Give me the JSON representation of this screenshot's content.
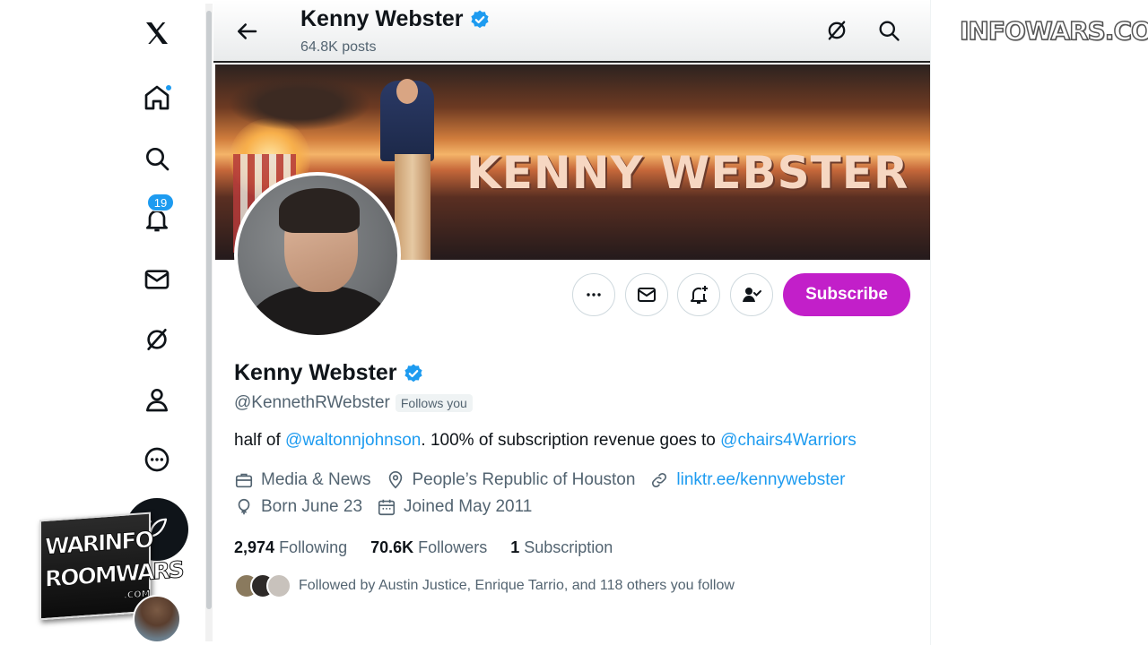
{
  "nav": {
    "items": [
      "x-logo",
      "home",
      "explore",
      "notifications",
      "messages",
      "grok",
      "profile",
      "more"
    ],
    "notifications_count": "19"
  },
  "header": {
    "name": "Kenny Webster",
    "posts": "64.8K posts"
  },
  "banner": {
    "text": "KENNY WEBSTER"
  },
  "actions": {
    "subscribe_label": "Subscribe"
  },
  "profile": {
    "name": "Kenny Webster",
    "handle": "@KennethRWebster",
    "follows_you": "Follows you",
    "bio_prefix": "half of ",
    "bio_link1": "@waltonnjohnson",
    "bio_middle": ". 100% of subscription revenue goes to ",
    "bio_link2": "@chairs4Warriors",
    "category": "Media & News",
    "location": "People’s Republic of Houston",
    "website": "linktr.ee/kennywebster",
    "born": "Born June 23",
    "joined": "Joined May 2011"
  },
  "stats": {
    "following_count": "2,974",
    "following_label": "Following",
    "followers_count": "70.6K",
    "followers_label": "Followers",
    "subscription_count": "1",
    "subscription_label": "Subscription"
  },
  "followed_by": "Followed by Austin Justice, Enrique Tarrio, and 118 others you follow",
  "overlay": {
    "watermark": "INFOWARS.COM",
    "warroom_line1": "WARINFO",
    "warroom_line2": "ROOMWARS",
    "warroom_line3": ".COM"
  },
  "colors": {
    "accent": "#1d9bf0",
    "subscribe": "#c21fc9",
    "text": "#0f1419",
    "secondary": "#536471"
  }
}
